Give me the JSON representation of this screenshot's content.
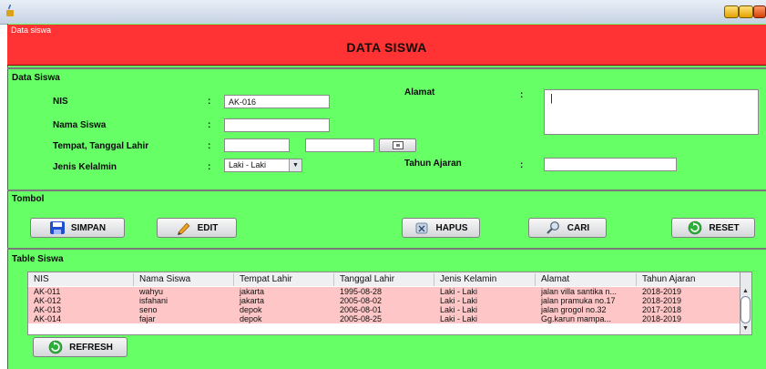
{
  "window": {
    "title_small": "Data siswa",
    "header_title": "DATA SISWA"
  },
  "colors": {
    "header_red": "#ff3333",
    "panel_green": "#66ff66",
    "row_pink": "#fec6c6"
  },
  "section_data": {
    "title": "Data Siswa",
    "nis_label": "NIS",
    "nis_value": "AK-016",
    "nama_label": "Nama Siswa",
    "nama_value": "",
    "ttl_label": "Tempat, Tanggal Lahir",
    "tempat_value": "",
    "tanggal_value": "",
    "jk_label": "Jenis Kelalmin",
    "jk_value": "Laki - Laki",
    "alamat_label": "Alamat",
    "alamat_value": "|",
    "tahun_label": "Tahun Ajaran",
    "tahun_value": "",
    "colon": ":"
  },
  "section_tombol": {
    "title": "Tombol",
    "simpan": "SIMPAN",
    "edit": "EDIT",
    "hapus": "HAPUS",
    "cari": "CARI",
    "reset": "RESET"
  },
  "section_table": {
    "title": "Table Siswa",
    "columns": [
      "NIS",
      "Nama Siswa",
      "Tempat Lahir",
      "Tanggal Lahir",
      "Jenis Kelamin",
      "Alamat",
      "Tahun Ajaran"
    ],
    "rows": [
      [
        "AK-011",
        "wahyu",
        "jakarta",
        "1995-08-28",
        "Laki - Laki",
        "jalan villa santika n...",
        "2018-2019"
      ],
      [
        "AK-012",
        "isfahani",
        "jakarta",
        "2005-08-02",
        "Laki - Laki",
        "jalan pramuka no.17",
        "2018-2019"
      ],
      [
        "AK-013",
        "seno",
        "depok",
        "2006-08-01",
        "Laki - Laki",
        "jalan grogol no.32",
        "2017-2018"
      ],
      [
        "AK-014",
        "fajar",
        "depok",
        "2005-08-25",
        "Laki - Laki",
        "Gg.karun mampa...",
        "2018-2019"
      ]
    ],
    "refresh": "REFRESH"
  }
}
